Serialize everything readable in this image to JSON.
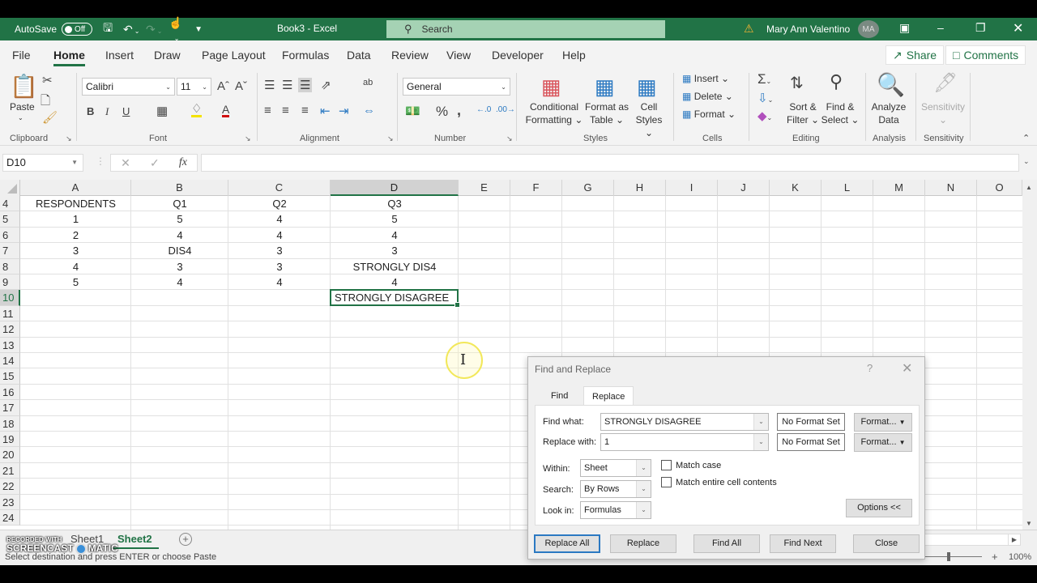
{
  "window": {
    "autosave_label": "AutoSave",
    "autosave_state": "Off",
    "title": "Book3  -  Excel",
    "search_placeholder": "Search",
    "user_name": "Mary Ann Valentino",
    "user_initials": "MA"
  },
  "menu": {
    "tabs": [
      "File",
      "Home",
      "Insert",
      "Draw",
      "Page Layout",
      "Formulas",
      "Data",
      "Review",
      "View",
      "Developer",
      "Help"
    ],
    "active_tab": "Home",
    "share_label": "Share",
    "comments_label": "Comments"
  },
  "ribbon": {
    "clipboard": {
      "label": "Clipboard",
      "paste_label": "Paste"
    },
    "font": {
      "label": "Font",
      "font_name": "Calibri",
      "font_size": "11"
    },
    "alignment": {
      "label": "Alignment"
    },
    "number": {
      "label": "Number",
      "format": "General"
    },
    "styles": {
      "label": "Styles",
      "conditional_1": "Conditional",
      "conditional_2": "Formatting",
      "format_table_1": "Format as",
      "format_table_2": "Table",
      "cell_styles_1": "Cell",
      "cell_styles_2": "Styles"
    },
    "cells": {
      "label": "Cells",
      "insert": "Insert",
      "delete": "Delete",
      "format": "Format"
    },
    "editing": {
      "label": "Editing",
      "sort_1": "Sort &",
      "sort_2": "Filter",
      "find_1": "Find &",
      "find_2": "Select"
    },
    "analysis": {
      "label": "Analysis",
      "analyze_1": "Analyze",
      "analyze_2": "Data"
    },
    "sensitivity": {
      "label": "Sensitivity",
      "button": "Sensitivity"
    }
  },
  "formula_bar": {
    "name_box": "D10",
    "formula": ""
  },
  "grid": {
    "columns": [
      "A",
      "B",
      "C",
      "D",
      "E",
      "F",
      "G",
      "H",
      "I",
      "J",
      "K",
      "L",
      "M",
      "N",
      "O"
    ],
    "selected_column": "D",
    "rows": [
      "4",
      "5",
      "6",
      "7",
      "8",
      "9",
      "10",
      "11",
      "12",
      "13",
      "14",
      "15",
      "16",
      "17",
      "18",
      "19",
      "20",
      "21",
      "22",
      "23",
      "24"
    ],
    "selected_row": "10",
    "cells": [
      [
        "RESPONDENTS",
        "Q1",
        "Q2",
        "Q3"
      ],
      [
        "1",
        "5",
        "4",
        "5"
      ],
      [
        "2",
        "4",
        "4",
        "4"
      ],
      [
        "3",
        "DIS4",
        "3",
        "3"
      ],
      [
        "4",
        "3",
        "3",
        "STRONGLY DIS4"
      ],
      [
        "5",
        "4",
        "4",
        "4"
      ],
      [
        "",
        "",
        "",
        "STRONGLY DISAGREE"
      ]
    ]
  },
  "sheets": {
    "tabs": [
      "Sheet1",
      "Sheet2"
    ],
    "active": "Sheet2"
  },
  "status": {
    "message": "Select destination and press ENTER or choose Paste",
    "zoom": "100%"
  },
  "watermark": {
    "line1": "RECORDED WITH",
    "line2a": "SCREENCAST",
    "line2b": "MATIC"
  },
  "dialog": {
    "title": "Find and Replace",
    "help": "?",
    "tabs": [
      "Find",
      "Replace"
    ],
    "active_tab": "Replace",
    "find_what_label": "Find what:",
    "find_what_value": "STRONGLY DISAGREE",
    "replace_with_label": "Replace with:",
    "replace_with_value": "1",
    "no_format_set": "No Format Set",
    "format_button": "Format...",
    "within_label": "Within:",
    "within_value": "Sheet",
    "search_label": "Search:",
    "search_value": "By Rows",
    "look_in_label": "Look in:",
    "look_in_value": "Formulas",
    "match_case_label": "Match case",
    "match_case_checked": false,
    "match_entire_label": "Match entire cell contents",
    "match_entire_checked": false,
    "options_button": "Options <<",
    "buttons": [
      "Replace All",
      "Replace",
      "Find All",
      "Find Next",
      "Close"
    ]
  }
}
